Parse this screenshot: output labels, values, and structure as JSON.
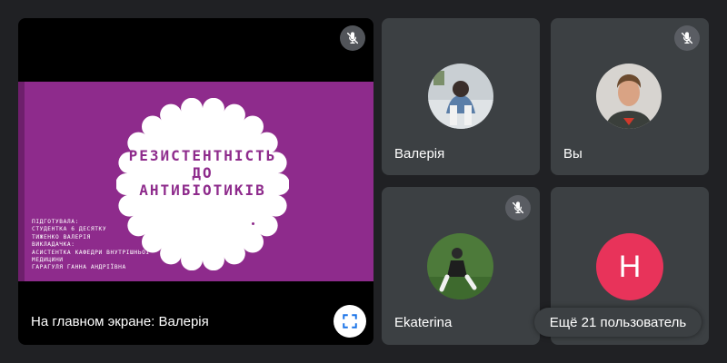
{
  "presentation": {
    "screen_label": "На главном экране: Валерія",
    "slide": {
      "title_lines": [
        "РЕЗИСТЕНТНІСТЬ",
        "ДО",
        "АНТИБІОТИКІВ"
      ],
      "credits": [
        "ПІДГОТУВАЛА:",
        "СТУДЕНТКА 6 ДЕСЯТКУ",
        "ТИЖЕНКО ВАЛЕРІЯ",
        "ВИКЛАДАЧКА:",
        "АСИСТЕНТКА КАФЕДРИ ВНУТРІШНЬОЇ",
        "МЕДИЦИНИ",
        "ГАРАГУЛЯ ГАННА АНДРІЇВНА"
      ]
    }
  },
  "participants": [
    {
      "name": "Валерія",
      "muted": false
    },
    {
      "name": "Вы",
      "muted": true
    },
    {
      "name": "Ekaterina",
      "muted": true
    },
    {
      "avatar_letter": "H",
      "muted": false
    }
  ],
  "more_participants_label": "Ещё 21 пользователь",
  "colors": {
    "background": "#202124",
    "tile": "#3c4043",
    "slide_purple": "#8e2b8c",
    "avatar_pink": "#e8335a",
    "pin_icon": "#1a73e8"
  }
}
